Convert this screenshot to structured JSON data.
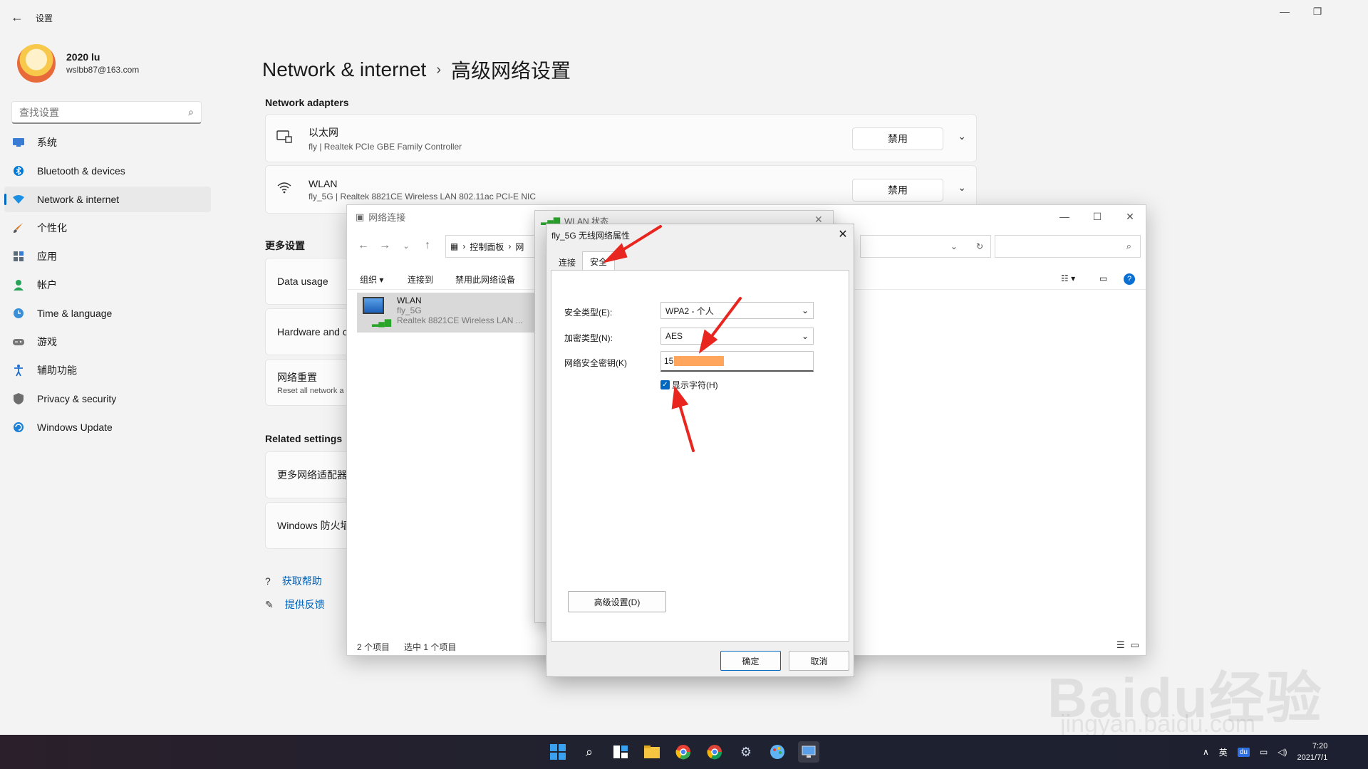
{
  "settings": {
    "app_title": "设置",
    "user": {
      "name": "2020 lu",
      "email": "wslbb87@163.com"
    },
    "search_placeholder": "查找设置",
    "nav": [
      {
        "label": "系统",
        "icon": "monitor-icon",
        "color": "#3a7bd5"
      },
      {
        "label": "Bluetooth & devices",
        "icon": "bluetooth-icon",
        "color": "#0078d4"
      },
      {
        "label": "Network & internet",
        "icon": "wifi-icon",
        "color": "#1a8fe3",
        "active": true
      },
      {
        "label": "个性化",
        "icon": "brush-icon",
        "color": "#d77a2b"
      },
      {
        "label": "应用",
        "icon": "apps-icon",
        "color": "#5b6b7a"
      },
      {
        "label": "帐户",
        "icon": "person-icon",
        "color": "#2aa35a"
      },
      {
        "label": "Time & language",
        "icon": "globe-clock-icon",
        "color": "#3a8fd8"
      },
      {
        "label": "游戏",
        "icon": "gamepad-icon",
        "color": "#777777"
      },
      {
        "label": "辅助功能",
        "icon": "accessibility-icon",
        "color": "#1f6fd1"
      },
      {
        "label": "Privacy & security",
        "icon": "shield-icon",
        "color": "#6d6d6d"
      },
      {
        "label": "Windows Update",
        "icon": "update-icon",
        "color": "#1a7fd6"
      }
    ],
    "breadcrumb": {
      "parent": "Network & internet",
      "current": "高级网络设置"
    },
    "adapters_title": "Network adapters",
    "adapters": [
      {
        "name": "以太网",
        "desc": "fly | Realtek PCIe GBE Family Controller",
        "button": "禁用"
      },
      {
        "name": "WLAN",
        "desc": "fly_5G | Realtek 8821CE Wireless LAN 802.11ac PCI-E NIC",
        "button": "禁用"
      }
    ],
    "more_title": "更多设置",
    "more_items": [
      {
        "label": "Data usage",
        "sub": ""
      },
      {
        "label": "Hardware and c",
        "sub": ""
      },
      {
        "label": "网络重置",
        "sub": "Reset all network a"
      }
    ],
    "related_title": "Related settings",
    "related_items": [
      {
        "label": "更多网络适配器"
      },
      {
        "label": "Windows 防火墙"
      }
    ],
    "help_links": [
      "获取帮助",
      "提供反馈"
    ]
  },
  "netconn": {
    "title": "网络连接",
    "address": "控制面板",
    "address_tail": "网",
    "commands": [
      "组织",
      "连接到",
      "禁用此网络设备"
    ],
    "item": {
      "name": "WLAN",
      "ssid": "fly_5G",
      "desc": "Realtek 8821CE Wireless LAN ..."
    },
    "status_count": "2 个项目",
    "status_selected": "选中 1 个项目"
  },
  "wlan_status": {
    "title": "WLAN 状态"
  },
  "props": {
    "title": "fly_5G 无线网络属性",
    "tabs": [
      "连接",
      "安全"
    ],
    "security_type_label": "安全类型(E):",
    "security_type_value": "WPA2 - 个人",
    "encryption_label": "加密类型(N):",
    "encryption_value": "AES",
    "key_label": "网络安全密钥(K)",
    "key_visible": "15",
    "show_chars": "显示字符(H)",
    "advanced_button": "高级设置(D)",
    "ok_button": "确定",
    "cancel_button": "取消"
  },
  "taskbar": {
    "tray_lang": "英",
    "time": "7:20",
    "date": "2021/7/1"
  },
  "watermark": {
    "brand": "Baidu经验",
    "url": "jingyan.baidu.com"
  },
  "colors": {
    "accent": "#0067c0",
    "annotation": "#e8261f",
    "mask": "#ffa55c"
  }
}
